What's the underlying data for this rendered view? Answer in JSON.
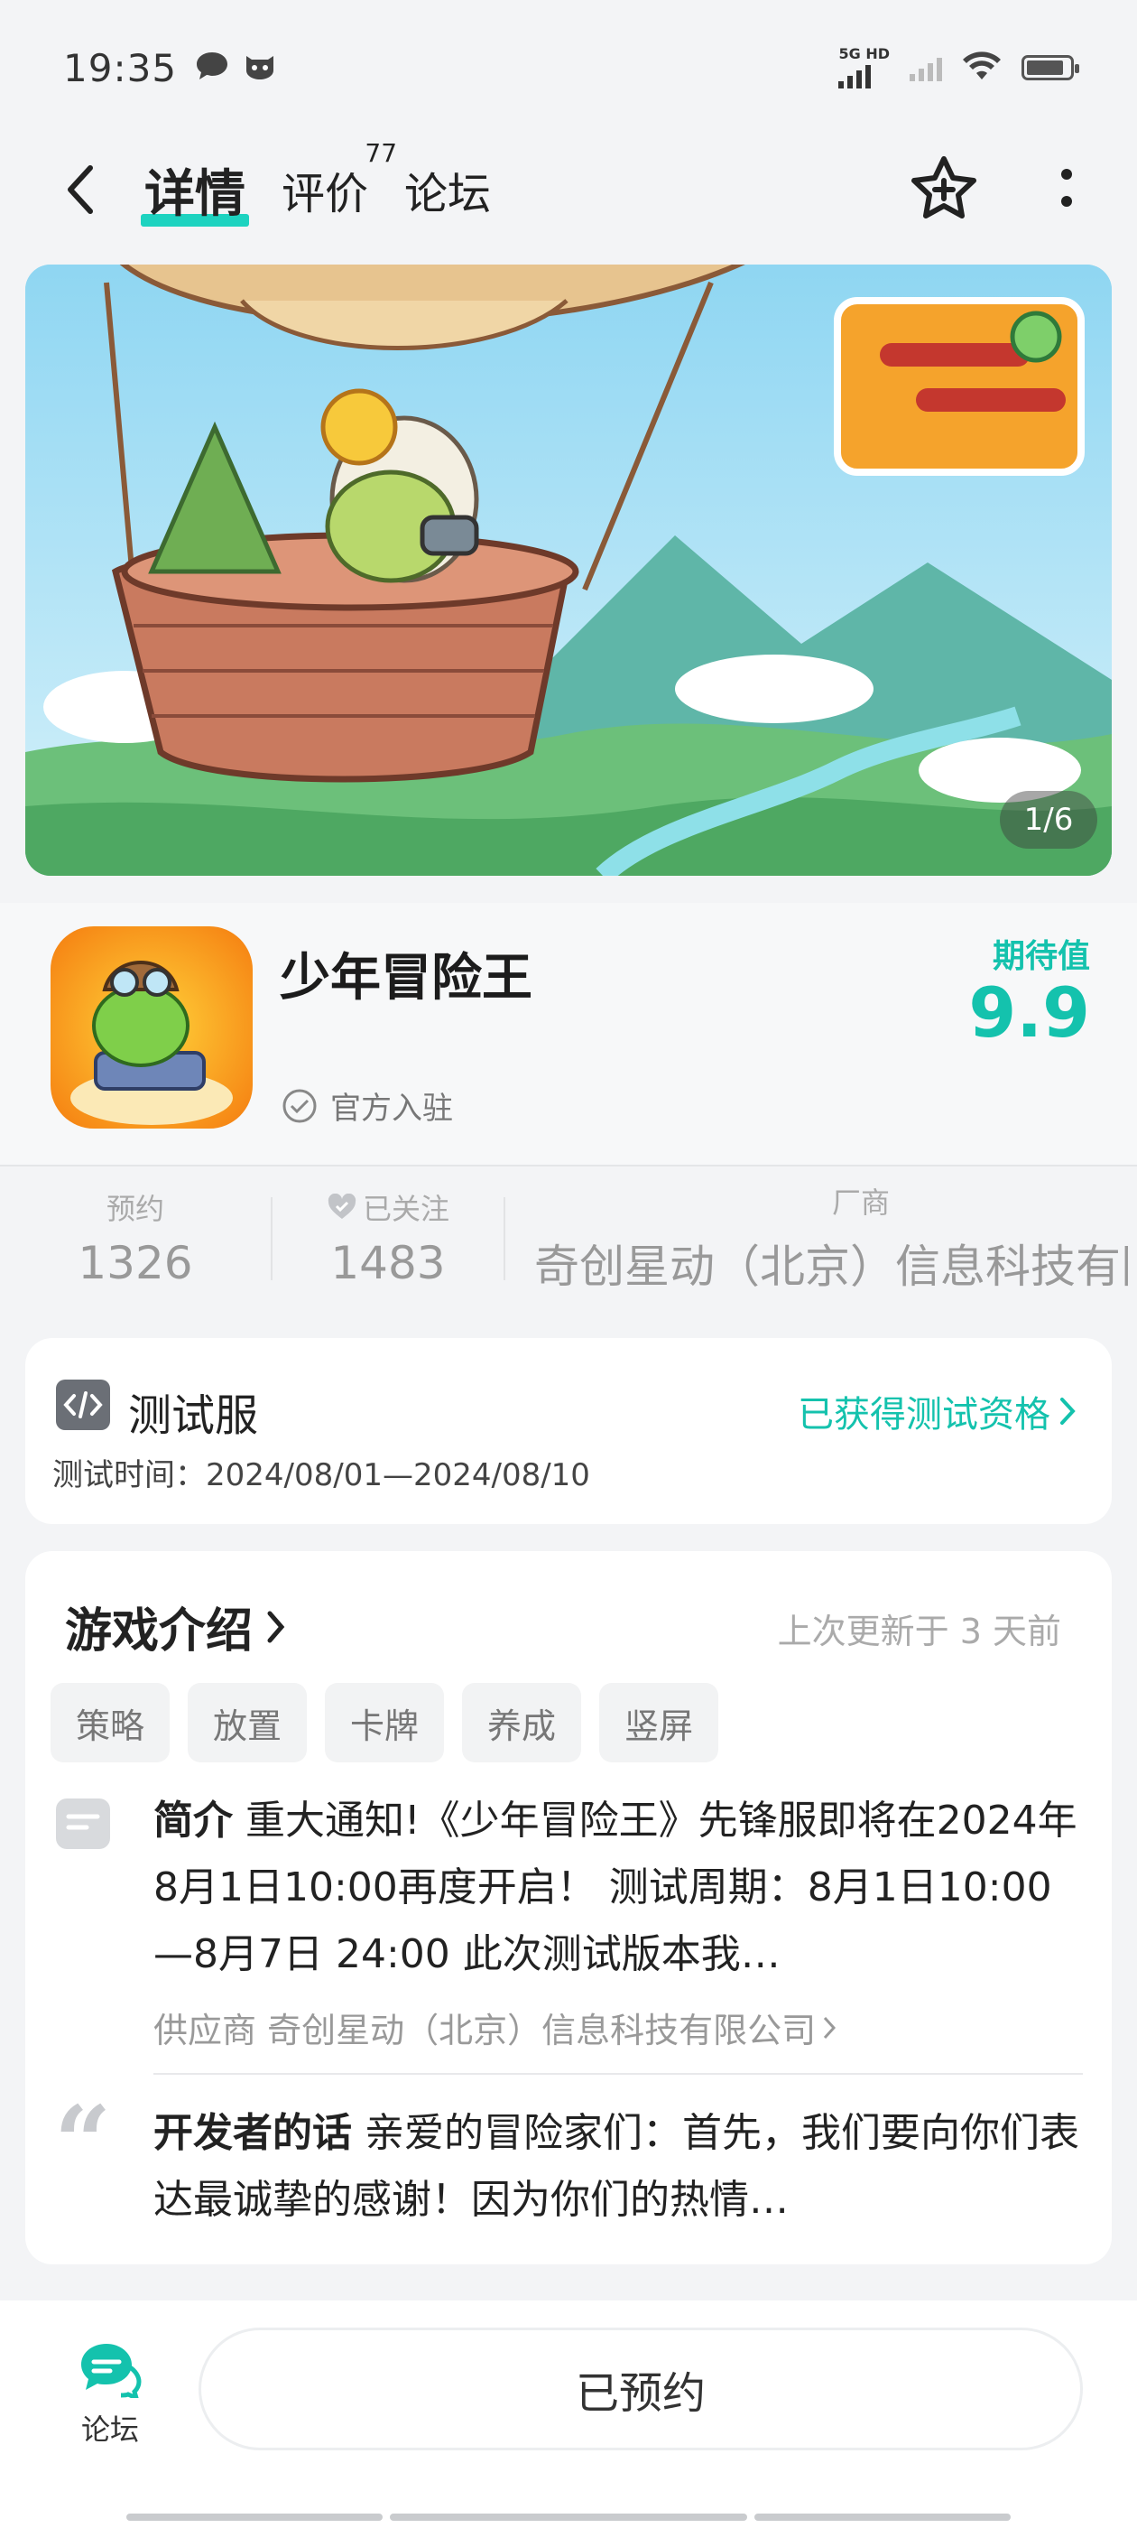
{
  "status_bar": {
    "time": "19:35",
    "network_label": "5G HD",
    "icons": [
      "message-icon",
      "cat-app-icon",
      "signal-icon",
      "wifi-icon",
      "battery-icon"
    ]
  },
  "nav": {
    "tabs": [
      {
        "label": "详情",
        "active": true
      },
      {
        "label": "评价",
        "count": "77"
      },
      {
        "label": "论坛"
      }
    ],
    "icons": [
      "back-icon",
      "star-add-icon",
      "more-icon"
    ]
  },
  "banner": {
    "counter": "1/6"
  },
  "app": {
    "title": "少年冒险王",
    "official": "官方入驻",
    "rating_label": "期待值",
    "rating_value": "9.9",
    "accent_color": "#14c2ad"
  },
  "stats": [
    {
      "label": "预约",
      "value": "1326"
    },
    {
      "label": "已关注",
      "value": "1483"
    },
    {
      "label": "厂商",
      "value": "奇创星动（北京）信息科技有限"
    }
  ],
  "test_server": {
    "title": "测试服",
    "time": "测试时间：2024/08/01—2024/08/10",
    "link": "已获得测试资格"
  },
  "intro": {
    "title": "游戏介绍",
    "updated": "上次更新于 3 天前",
    "tags": [
      "策略",
      "放置",
      "卡牌",
      "养成",
      "竖屏"
    ],
    "desc_label": "简介",
    "desc_text": " 重大通知!《少年冒险王》先锋服即将在2024年8月1日10:00再度开启！ 测试周期：8月1日10:00—8月7日 24:00 此次测试版本我…",
    "supplier": "供应商 奇创星动（北京）信息科技有限公司",
    "dev_label": "开发者的话",
    "dev_text": " 亲爱的冒险家们：首先，我们要向你们表达最诚挚的感谢！因为你们的热情…"
  },
  "bottom": {
    "forum_label": "论坛",
    "reserve_label": "已预约"
  }
}
